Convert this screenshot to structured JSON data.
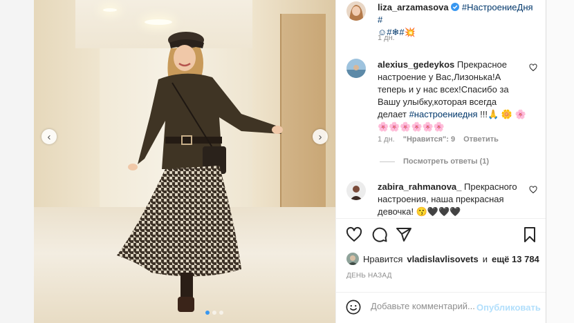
{
  "post": {
    "author": "liza_arzamasova",
    "caption_tags": "#НастроениеДня #",
    "caption_line2": "☺#❄#",
    "caption_sticker": "💥",
    "time": "1 дн."
  },
  "comments": [
    {
      "user": "alexius_gedeykos",
      "text_lead": "Прекрасное настроение у Вас,Лизонька!А теперь и у нас всех!Спасибо за Вашу улыбку,которая всегда делает ",
      "hashtag": "#настроениедня",
      "text_tail": " !!!🙏 🌼 🌸 🌸🌸🌸🌸🌸🌸",
      "time": "1 дн.",
      "likes": "\"Нравится\": 9",
      "reply": "Ответить",
      "view_replies": "Посмотреть ответы (1)"
    },
    {
      "user": "zabira_rahmanova_",
      "text": "Прекрасного настроения, наша прекрасная девочка! 😗🖤🖤🖤"
    }
  ],
  "likes": {
    "prefix": "Нравится",
    "user": "vladislavlisovets",
    "middle": "и",
    "rest": "ещё 13 784"
  },
  "post_time": "ДЕНЬ НАЗАД",
  "add_comment": {
    "placeholder": "Добавьте комментарий...",
    "publish": "Опубликовать"
  },
  "icons": {
    "like": "heart-icon",
    "comment": "comment-icon",
    "share": "share-icon",
    "save": "bookmark-icon",
    "emoji": "emoji-icon",
    "verified": "verified-badge-icon"
  },
  "colors": {
    "link": "#00376b",
    "verified": "#3897f0",
    "publish_disabled": "#b2dffc",
    "muted": "#8e8e8e"
  }
}
